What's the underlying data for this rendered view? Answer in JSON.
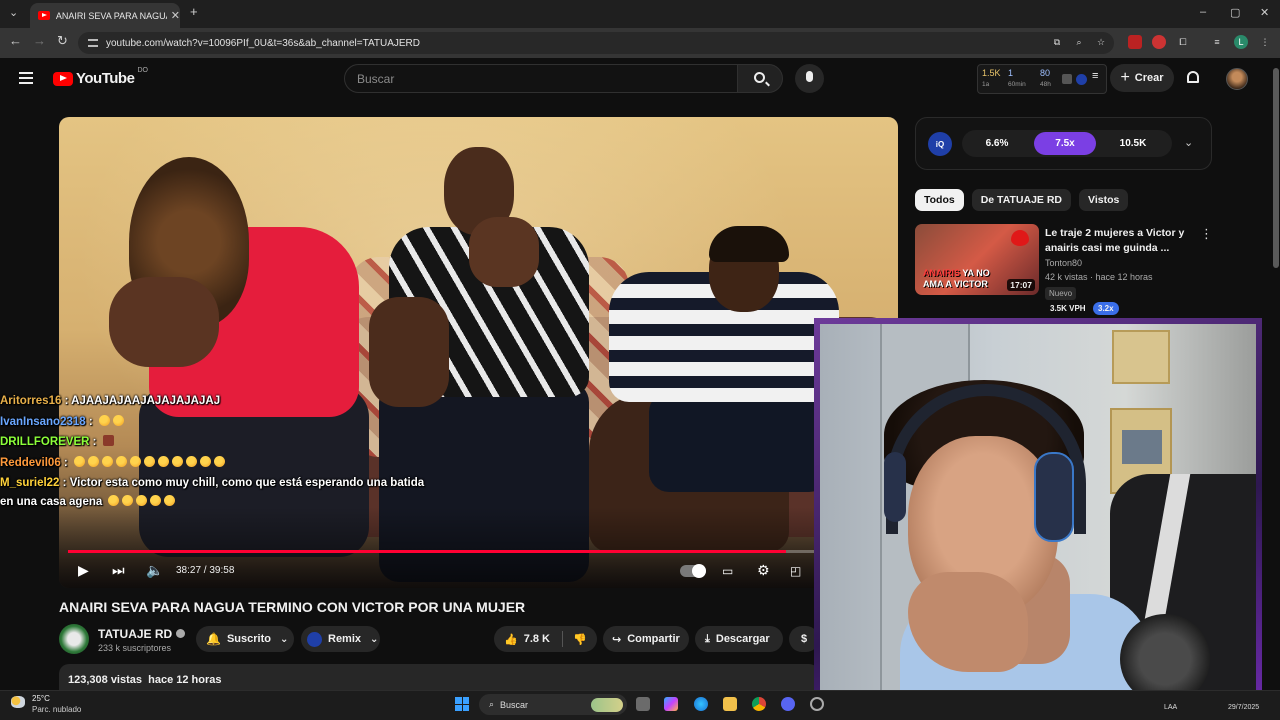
{
  "browser": {
    "tab_title": "ANAIRI SEVA PARA NAGUA TERMINO CON VICTOR POR UNA MUJER",
    "url": "youtube.com/watch?v=10096PIf_0U&t=36s&ab_channel=TATUAJERD",
    "profile_initial": "L"
  },
  "header": {
    "logo": "YouTube",
    "country": "DO",
    "search_placeholder": "Buscar",
    "crear_label": "Crear",
    "stats": [
      {
        "value": "1.5K",
        "sub": "1a"
      },
      {
        "value": "1",
        "sub": "60min"
      },
      {
        "value": "80",
        "sub": "48h"
      }
    ]
  },
  "player": {
    "time": "38:27 / 39:58",
    "progress": 0.962
  },
  "chat": [
    {
      "user": "Aritorres16",
      "color": "#e8b04a",
      "msg": "AJAAJAJAAJAJAJAJAJAJ",
      "emotes": 0
    },
    {
      "user": "IvanInsano2318",
      "color": "#6aa7ff",
      "msg": "",
      "emotes": 2
    },
    {
      "user": "DRILLFOREVER",
      "color": "#8cff3a",
      "msg": "",
      "emotes": 1
    },
    {
      "user": "Reddevil06",
      "color": "#ff9a3c",
      "msg": "",
      "emotes": 11
    },
    {
      "user": "M_suriel22",
      "color": "#ffd23a",
      "msg": "Victor esta como muy chill, como que está esperando una batida",
      "emotes": 0
    },
    {
      "user": "",
      "color": "#ffffff",
      "msg": "en una casa agena",
      "emotes": 5
    }
  ],
  "video": {
    "title": "ANAIRI SEVA PARA NAGUA TERMINO CON VICTOR POR UNA MUJER",
    "channel": "TATUAJE RD",
    "subscribers": "233 k suscriptores",
    "subscribed_label": "Suscrito",
    "remix_label": "Remix",
    "likes": "7.8 K",
    "share_label": "Compartir",
    "download_label": "Descargar",
    "views": "123,308 vistas",
    "age": "hace 12 horas"
  },
  "iq_panel": {
    "logo": "iQ",
    "segments": [
      "6.6%",
      "7.5x",
      "10.5K"
    ]
  },
  "chips": [
    "Todos",
    "De TATUAJE RD",
    "Vistos"
  ],
  "recommendation": {
    "title": "Le traje 2 mujeres a Victor y anairis casi me guinda ...",
    "channel": "Tonton80",
    "meta": "42 k vistas · hace 12 horas",
    "badge": "Nuevo",
    "vph": "3.5K VPH",
    "multiplier": "3.2x",
    "duration": "17:07",
    "overlay_line1": "ANAIRIS",
    "overlay_line1b": "YA NO",
    "overlay_line2": "AMA A VICTOR"
  },
  "taskbar": {
    "temperature": "25°C",
    "weather": "Parc. nublado",
    "search": "Buscar",
    "lang": "LAA",
    "date": "29/7/2025"
  },
  "colors": {
    "progress": "#ff0033",
    "iq_active": "#7b3fe4",
    "youtube_red": "#ff0000"
  }
}
